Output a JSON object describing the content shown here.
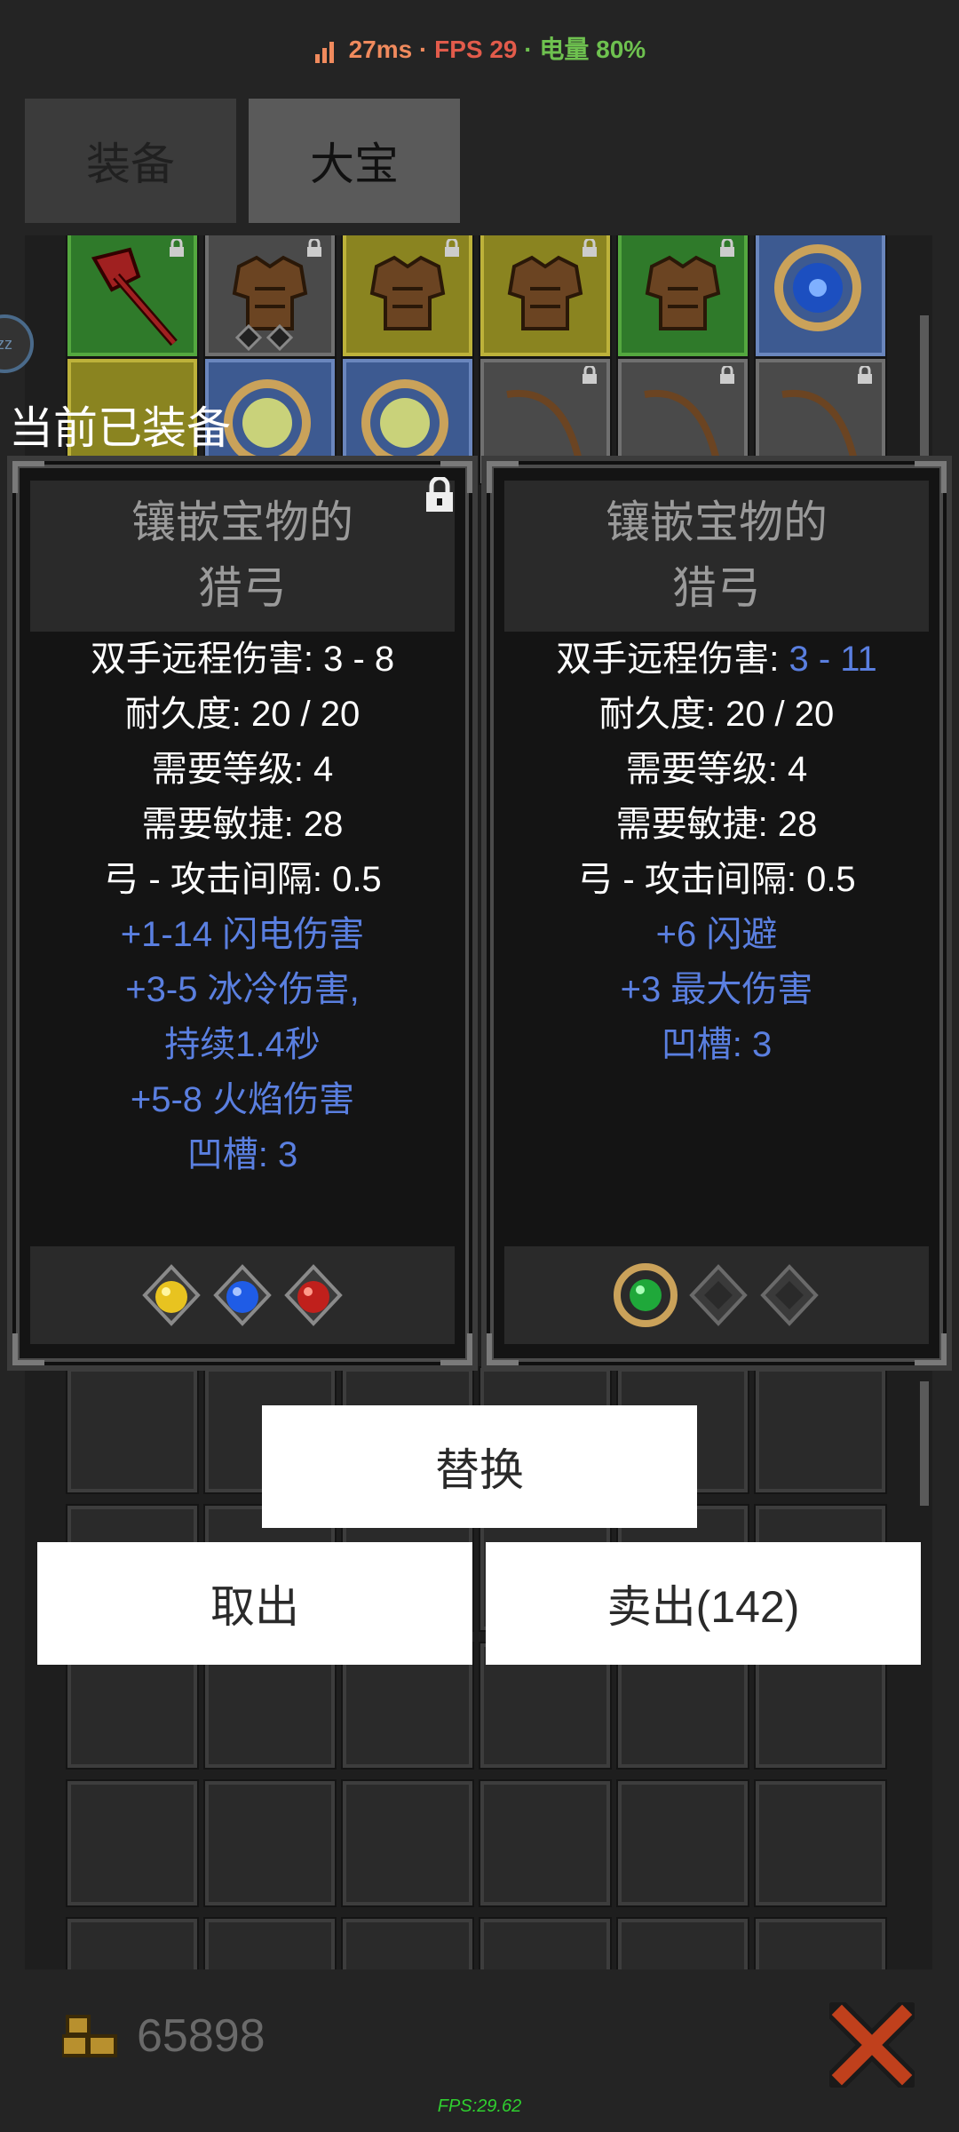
{
  "status_bar": {
    "ping": "27ms",
    "fps": "FPS 29",
    "battery": "电量 80%",
    "separator": "·"
  },
  "tabs": [
    {
      "label": "装备",
      "active": false
    },
    {
      "label": "大宝",
      "active": true
    }
  ],
  "equipped_label": "当前已装备",
  "bubble_text": "zz",
  "left_item": {
    "title_line1": "镶嵌宝物的",
    "title_line2": "猎弓",
    "stats": [
      {
        "text": "双手远程伤害: 3 - 8",
        "magic": false
      },
      {
        "text": "耐久度: 20 / 20",
        "magic": false
      },
      {
        "text": "需要等级: 4",
        "magic": false
      },
      {
        "text": "需要敏捷: 28",
        "magic": false
      },
      {
        "text": "弓 - 攻击间隔: 0.5",
        "magic": false
      },
      {
        "text": "+1-14 闪电伤害",
        "magic": true
      },
      {
        "text": "+3-5 冰冷伤害,",
        "magic": true
      },
      {
        "text": "持续1.4秒",
        "magic": true
      },
      {
        "text": "+5-8 火焰伤害",
        "magic": true
      },
      {
        "text": "凹槽: 3",
        "magic": true
      }
    ],
    "gems": [
      "yellow-gem",
      "blue-gem",
      "red-gem"
    ]
  },
  "right_item": {
    "title_line1": "镶嵌宝物的",
    "title_line2": "猎弓",
    "damage_label": "双手远程伤害: ",
    "damage_value": "3 - 11",
    "stats": [
      {
        "text": "耐久度: 20 / 20",
        "magic": false
      },
      {
        "text": "需要等级: 4",
        "magic": false
      },
      {
        "text": "需要敏捷: 28",
        "magic": false
      },
      {
        "text": "弓 - 攻击间隔: 0.5",
        "magic": false
      },
      {
        "text": "+6 闪避",
        "magic": true
      },
      {
        "text": "+3 最大伤害",
        "magic": true
      },
      {
        "text": "凹槽: 3",
        "magic": true
      }
    ],
    "gems": [
      "green-gem",
      "empty-socket",
      "empty-socket"
    ]
  },
  "buttons": {
    "replace": "替换",
    "take_out": "取出",
    "sell": "卖出(142)"
  },
  "gold": "65898",
  "debug_fps": "FPS:29.62",
  "colors": {
    "magic_text": "#5a7fe0",
    "ping": "#f08a5d",
    "fps": "#e25b4b",
    "battery": "#6ec14f"
  }
}
